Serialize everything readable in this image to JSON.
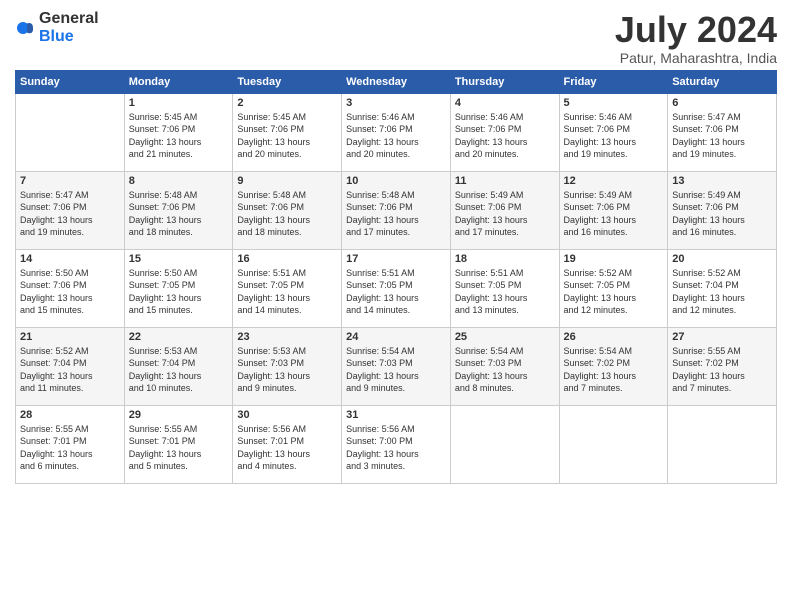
{
  "header": {
    "logo_general": "General",
    "logo_blue": "Blue",
    "title": "July 2024",
    "subtitle": "Patur, Maharashtra, India"
  },
  "days_of_week": [
    "Sunday",
    "Monday",
    "Tuesday",
    "Wednesday",
    "Thursday",
    "Friday",
    "Saturday"
  ],
  "weeks": [
    [
      {
        "day": "",
        "info": ""
      },
      {
        "day": "1",
        "info": "Sunrise: 5:45 AM\nSunset: 7:06 PM\nDaylight: 13 hours\nand 21 minutes."
      },
      {
        "day": "2",
        "info": "Sunrise: 5:45 AM\nSunset: 7:06 PM\nDaylight: 13 hours\nand 20 minutes."
      },
      {
        "day": "3",
        "info": "Sunrise: 5:46 AM\nSunset: 7:06 PM\nDaylight: 13 hours\nand 20 minutes."
      },
      {
        "day": "4",
        "info": "Sunrise: 5:46 AM\nSunset: 7:06 PM\nDaylight: 13 hours\nand 20 minutes."
      },
      {
        "day": "5",
        "info": "Sunrise: 5:46 AM\nSunset: 7:06 PM\nDaylight: 13 hours\nand 19 minutes."
      },
      {
        "day": "6",
        "info": "Sunrise: 5:47 AM\nSunset: 7:06 PM\nDaylight: 13 hours\nand 19 minutes."
      }
    ],
    [
      {
        "day": "7",
        "info": "Sunrise: 5:47 AM\nSunset: 7:06 PM\nDaylight: 13 hours\nand 19 minutes."
      },
      {
        "day": "8",
        "info": "Sunrise: 5:48 AM\nSunset: 7:06 PM\nDaylight: 13 hours\nand 18 minutes."
      },
      {
        "day": "9",
        "info": "Sunrise: 5:48 AM\nSunset: 7:06 PM\nDaylight: 13 hours\nand 18 minutes."
      },
      {
        "day": "10",
        "info": "Sunrise: 5:48 AM\nSunset: 7:06 PM\nDaylight: 13 hours\nand 17 minutes."
      },
      {
        "day": "11",
        "info": "Sunrise: 5:49 AM\nSunset: 7:06 PM\nDaylight: 13 hours\nand 17 minutes."
      },
      {
        "day": "12",
        "info": "Sunrise: 5:49 AM\nSunset: 7:06 PM\nDaylight: 13 hours\nand 16 minutes."
      },
      {
        "day": "13",
        "info": "Sunrise: 5:49 AM\nSunset: 7:06 PM\nDaylight: 13 hours\nand 16 minutes."
      }
    ],
    [
      {
        "day": "14",
        "info": "Sunrise: 5:50 AM\nSunset: 7:06 PM\nDaylight: 13 hours\nand 15 minutes."
      },
      {
        "day": "15",
        "info": "Sunrise: 5:50 AM\nSunset: 7:05 PM\nDaylight: 13 hours\nand 15 minutes."
      },
      {
        "day": "16",
        "info": "Sunrise: 5:51 AM\nSunset: 7:05 PM\nDaylight: 13 hours\nand 14 minutes."
      },
      {
        "day": "17",
        "info": "Sunrise: 5:51 AM\nSunset: 7:05 PM\nDaylight: 13 hours\nand 14 minutes."
      },
      {
        "day": "18",
        "info": "Sunrise: 5:51 AM\nSunset: 7:05 PM\nDaylight: 13 hours\nand 13 minutes."
      },
      {
        "day": "19",
        "info": "Sunrise: 5:52 AM\nSunset: 7:05 PM\nDaylight: 13 hours\nand 12 minutes."
      },
      {
        "day": "20",
        "info": "Sunrise: 5:52 AM\nSunset: 7:04 PM\nDaylight: 13 hours\nand 12 minutes."
      }
    ],
    [
      {
        "day": "21",
        "info": "Sunrise: 5:52 AM\nSunset: 7:04 PM\nDaylight: 13 hours\nand 11 minutes."
      },
      {
        "day": "22",
        "info": "Sunrise: 5:53 AM\nSunset: 7:04 PM\nDaylight: 13 hours\nand 10 minutes."
      },
      {
        "day": "23",
        "info": "Sunrise: 5:53 AM\nSunset: 7:03 PM\nDaylight: 13 hours\nand 9 minutes."
      },
      {
        "day": "24",
        "info": "Sunrise: 5:54 AM\nSunset: 7:03 PM\nDaylight: 13 hours\nand 9 minutes."
      },
      {
        "day": "25",
        "info": "Sunrise: 5:54 AM\nSunset: 7:03 PM\nDaylight: 13 hours\nand 8 minutes."
      },
      {
        "day": "26",
        "info": "Sunrise: 5:54 AM\nSunset: 7:02 PM\nDaylight: 13 hours\nand 7 minutes."
      },
      {
        "day": "27",
        "info": "Sunrise: 5:55 AM\nSunset: 7:02 PM\nDaylight: 13 hours\nand 7 minutes."
      }
    ],
    [
      {
        "day": "28",
        "info": "Sunrise: 5:55 AM\nSunset: 7:01 PM\nDaylight: 13 hours\nand 6 minutes."
      },
      {
        "day": "29",
        "info": "Sunrise: 5:55 AM\nSunset: 7:01 PM\nDaylight: 13 hours\nand 5 minutes."
      },
      {
        "day": "30",
        "info": "Sunrise: 5:56 AM\nSunset: 7:01 PM\nDaylight: 13 hours\nand 4 minutes."
      },
      {
        "day": "31",
        "info": "Sunrise: 5:56 AM\nSunset: 7:00 PM\nDaylight: 13 hours\nand 3 minutes."
      },
      {
        "day": "",
        "info": ""
      },
      {
        "day": "",
        "info": ""
      },
      {
        "day": "",
        "info": ""
      }
    ]
  ]
}
